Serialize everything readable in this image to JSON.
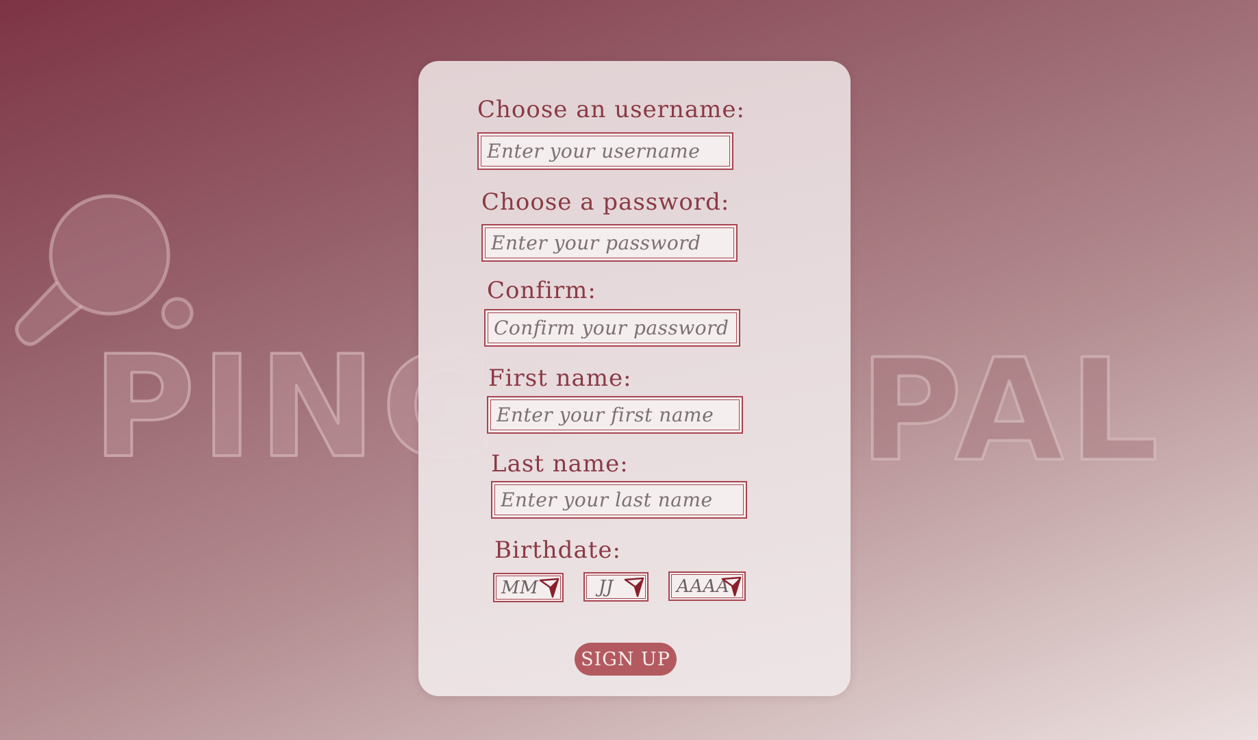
{
  "brand": {
    "logo_word_left": "PING",
    "logo_word_right": "PAL",
    "logo_icon": "ping-pong-paddle-icon"
  },
  "form": {
    "username": {
      "label": "Choose an username:",
      "placeholder": "Enter your username"
    },
    "password": {
      "label": "Choose a password:",
      "placeholder": "Enter your password"
    },
    "confirm": {
      "label": "Confirm:",
      "placeholder": "Confirm your password"
    },
    "first_name": {
      "label": "First name:",
      "placeholder": "Enter your first name"
    },
    "last_name": {
      "label": "Last name:",
      "placeholder": "Enter your last name"
    },
    "birthdate": {
      "label": "Birthdate:",
      "month": "MM",
      "day": "JJ",
      "year": "AAAA",
      "dropdown_icon": "chevron-down-icon"
    },
    "submit_label": "SIGN UP"
  },
  "colors": {
    "accent": "#a8444f",
    "label_text": "#8a3a44",
    "button_bg": "#b35a60",
    "bg_dark": "#7d3444",
    "bg_light": "#ece0e0"
  }
}
